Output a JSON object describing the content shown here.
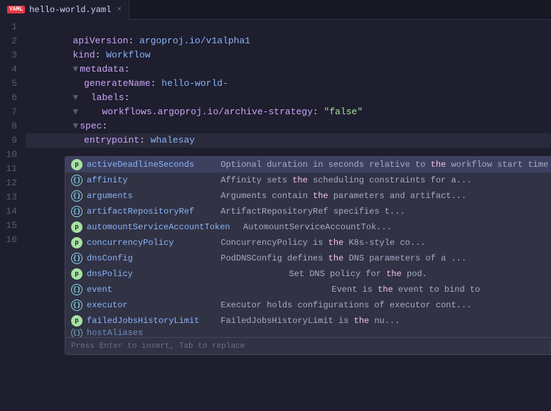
{
  "tab": {
    "filename": "hello-world.yaml",
    "close_label": "×",
    "yaml_badge": "YAML"
  },
  "lines": [
    {
      "num": 1,
      "tokens": [
        {
          "t": "kw",
          "v": "apiVersion"
        },
        {
          "t": "plain",
          "v": ": "
        },
        {
          "t": "val",
          "v": "argoproj.io/v1alpha1"
        }
      ]
    },
    {
      "num": 2,
      "tokens": [
        {
          "t": "kw",
          "v": "kind"
        },
        {
          "t": "plain",
          "v": ": "
        },
        {
          "t": "val",
          "v": "Workflow"
        }
      ]
    },
    {
      "num": 3,
      "tokens": [
        {
          "t": "collapse",
          "v": "▼"
        },
        {
          "t": "kw",
          "v": "metadata"
        },
        {
          "t": "plain",
          "v": ":"
        }
      ]
    },
    {
      "num": 4,
      "tokens": [
        {
          "t": "plain",
          "v": "  "
        },
        {
          "t": "kw",
          "v": "generateName"
        },
        {
          "t": "plain",
          "v": ": "
        },
        {
          "t": "val",
          "v": "hello-world-"
        }
      ]
    },
    {
      "num": 5,
      "tokens": [
        {
          "t": "collapse",
          "v": "▼"
        },
        {
          "t": "plain",
          "v": "  "
        },
        {
          "t": "kw",
          "v": "labels"
        },
        {
          "t": "plain",
          "v": ":"
        }
      ]
    },
    {
      "num": 6,
      "tokens": [
        {
          "t": "collapse",
          "v": "▼"
        },
        {
          "t": "plain",
          "v": "    "
        },
        {
          "t": "kw",
          "v": "workflows.argoproj.io/archive-strategy"
        },
        {
          "t": "plain",
          "v": ": "
        },
        {
          "t": "str",
          "v": "\"false\""
        }
      ]
    },
    {
      "num": 7,
      "tokens": [
        {
          "t": "collapse",
          "v": "▼"
        },
        {
          "t": "kw",
          "v": "spec"
        },
        {
          "t": "plain",
          "v": ":"
        }
      ]
    },
    {
      "num": 8,
      "tokens": [
        {
          "t": "plain",
          "v": "  "
        },
        {
          "t": "kw",
          "v": "entrypoint"
        },
        {
          "t": "plain",
          "v": ": "
        },
        {
          "t": "val",
          "v": "whalesay"
        }
      ]
    },
    {
      "num": 9,
      "tokens": []
    },
    {
      "num": 10,
      "tokens": []
    },
    {
      "num": 11,
      "tokens": []
    },
    {
      "num": 12,
      "tokens": []
    },
    {
      "num": 13,
      "tokens": []
    },
    {
      "num": 14,
      "tokens": []
    },
    {
      "num": 15,
      "tokens": []
    },
    {
      "num": 16,
      "tokens": []
    }
  ],
  "autocomplete": {
    "footer": "Press Enter to insert, Tab to replace",
    "items": [
      {
        "id": "activeDeadlineSeconds",
        "badge_type": "p",
        "badge_label": "p",
        "name": "activeDeadlineSeconds",
        "desc": "Optional duration in seconds relative to the workflow start time",
        "selected": true
      },
      {
        "id": "affinity",
        "badge_type": "obj",
        "badge_label": "{}",
        "name": "affinity",
        "desc": "Affinity sets the scheduling constraints for a...",
        "selected": false
      },
      {
        "id": "arguments",
        "badge_type": "obj",
        "badge_label": "{}",
        "name": "arguments",
        "desc": "Arguments contain the parameters and artifact...",
        "selected": false
      },
      {
        "id": "artifactRepositoryRef",
        "badge_type": "obj",
        "badge_label": "{}",
        "name": "artifactRepositoryRef",
        "desc": "ArtifactRepositoryRef specifies t...",
        "selected": false
      },
      {
        "id": "automountServiceAccountToken",
        "badge_type": "p",
        "badge_label": "p",
        "name": "automountServiceAccountToken",
        "desc": "AutomountServiceAccountTok...",
        "selected": false
      },
      {
        "id": "concurrencyPolicy",
        "badge_type": "p",
        "badge_label": "p",
        "name": "concurrencyPolicy",
        "desc": "ConcurrencyPolicy is the K8s-style co...",
        "selected": false
      },
      {
        "id": "dnsConfig",
        "badge_type": "obj",
        "badge_label": "{}",
        "name": "dnsConfig",
        "desc": "PodDNSConfig defines the DNS parameters of a ...",
        "selected": false
      },
      {
        "id": "dnsPolicy",
        "badge_type": "p",
        "badge_label": "p",
        "name": "dnsPolicy",
        "desc": "Set DNS policy for the pod.",
        "selected": false
      },
      {
        "id": "event",
        "badge_type": "obj",
        "badge_label": "{}",
        "name": "event",
        "desc": "Event is the event to bind to",
        "selected": false
      },
      {
        "id": "executor",
        "badge_type": "obj",
        "badge_label": "{}",
        "name": "executor",
        "desc": "Executor holds configurations of executor cont...",
        "selected": false
      },
      {
        "id": "failedJobsHistoryLimit",
        "badge_type": "p",
        "badge_label": "p",
        "name": "failedJobsHistoryLimit",
        "desc": "FailedJobsHistoryLimit is the nu...",
        "selected": false
      },
      {
        "id": "hostAliases",
        "badge_type": "obj",
        "badge_label": "{}",
        "name": "hostAliases",
        "desc": "",
        "selected": false,
        "partial": true
      }
    ]
  }
}
